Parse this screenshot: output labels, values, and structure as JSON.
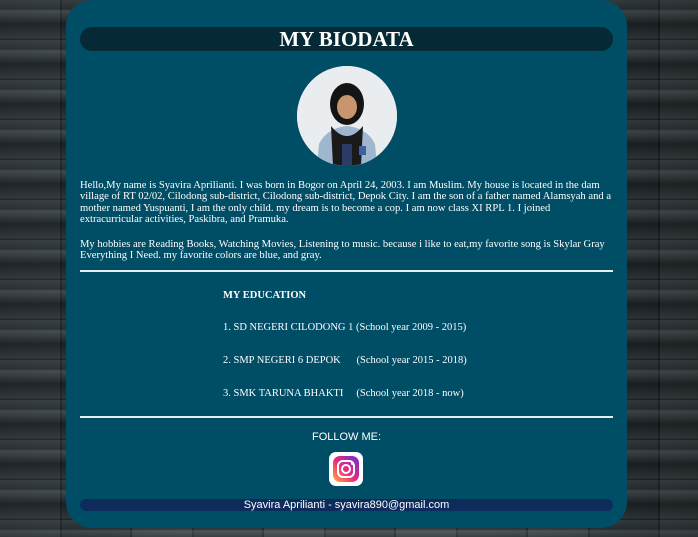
{
  "header": {
    "title": "MY BIODATA"
  },
  "bio": {
    "paragraph1": "Hello,My name is Syavira Aprilianti. I was born in Bogor on April 24, 2003. I am Muslim. My house is located in the dam village of RT 02/02, Cilodong sub-district, Cilodong sub-district, Depok City. I am the son of a father named Alamsyah and a mother named Yuspuanti, I am the only child. my dream is to become a cop. I am now class XI RPL 1. I joined extracurricular activities, Paskibra, and Pramuka.",
    "paragraph2": "My hobbies are Reading Books, Watching Movies, Listening to music. because i like to eat,my favorite song is Skylar Gray Everything I Need. my favorite colors are blue, and gray."
  },
  "education": {
    "title": "MY EDUCATION",
    "items": [
      "1. SD NEGERI CILODONG 1 (School year 2009 - 2015)",
      "2. SMP NEGERI 6 DEPOK      (School year 2015 - 2018)",
      "3. SMK TARUNA BHAKTI     (School year 2018 - now)"
    ]
  },
  "follow": {
    "label": "FOLLOW ME:",
    "icon": "instagram-icon"
  },
  "footer": {
    "text": "Syavira Aprilianti - syavira890@gmail.com"
  },
  "colors": {
    "card": "#004d66",
    "title_bar": "#052a36",
    "footer_bar": "#0d2c5c"
  }
}
